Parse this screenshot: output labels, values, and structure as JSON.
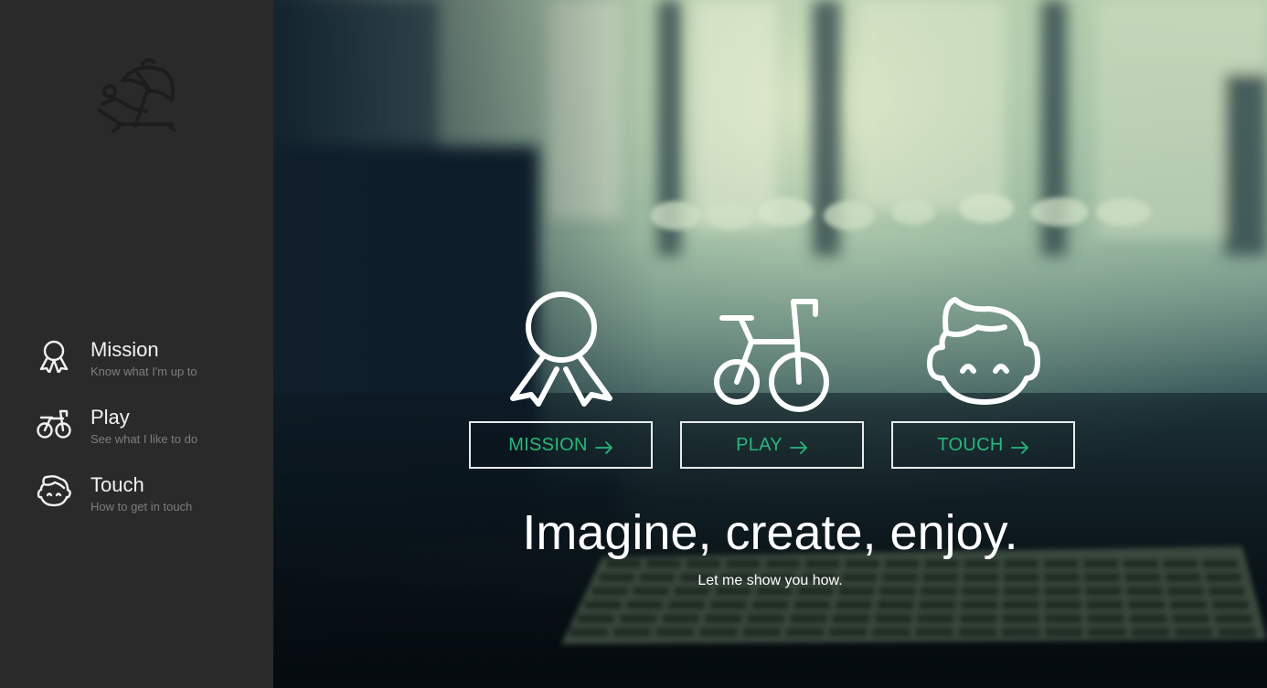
{
  "sidebar": {
    "logo_icon": "beach-umbrella-lounger-icon",
    "nav": [
      {
        "icon": "ribbon-award-icon",
        "title": "Mission",
        "subtitle": "Know what I'm up to"
      },
      {
        "icon": "bicycle-icon",
        "title": "Play",
        "subtitle": "See what I like to do"
      },
      {
        "icon": "smiling-face-icon",
        "title": "Touch",
        "subtitle": "How to get in touch"
      }
    ]
  },
  "hero": {
    "background": "blurred-desk-keyboard-photo",
    "features": [
      {
        "icon": "ribbon-award-icon",
        "button_label": "MISSION",
        "button_icon": "arrow-right-icon"
      },
      {
        "icon": "bicycle-icon",
        "button_label": "PLAY",
        "button_icon": "arrow-right-icon"
      },
      {
        "icon": "smiling-face-icon",
        "button_label": "TOUCH",
        "button_icon": "arrow-right-icon"
      }
    ],
    "headline": "Imagine, create, enjoy.",
    "subheadline": "Let me show you how."
  },
  "colors": {
    "sidebar_bg": "#2a2a2a",
    "accent_green": "#24b87a",
    "nav_title": "#f2f2f2",
    "nav_subtitle": "#7e7e7e",
    "button_border": "#e9ecec"
  }
}
